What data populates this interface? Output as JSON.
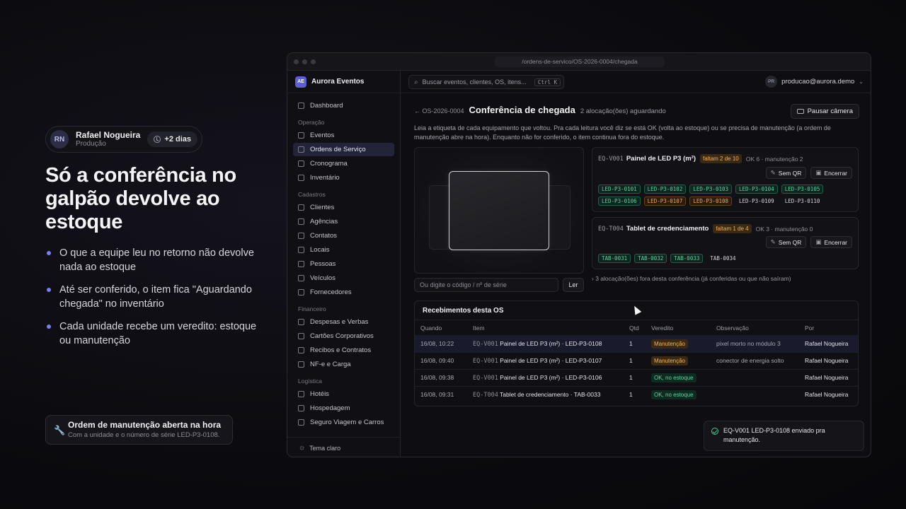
{
  "narrative": {
    "user": {
      "initials": "RN",
      "name": "Rafael Nogueira",
      "role": "Produção",
      "badge": "+2 dias"
    },
    "headline": "Só a conferência no galpão devolve ao estoque",
    "bullets": [
      "O que a equipe leu no retorno não devolve nada ao estoque",
      "Até ser conferido, o item fica \"Aguardando chegada\" no inventário",
      "Cada unidade recebe um veredito: estoque ou manutenção"
    ],
    "callout": {
      "title": "Ordem de manutenção aberta na hora",
      "subtitle": "Com a unidade e o número de série LED-P3-0108."
    }
  },
  "window": {
    "url": "/ordens-de-servico/OS-2026-0004/chegada"
  },
  "sidebar": {
    "brand_logo": "AE",
    "brand_name": "Aurora Eventos",
    "dashboard": "Dashboard",
    "sections": [
      {
        "title": "Operação",
        "items": [
          "Eventos",
          "Ordens de Serviço",
          "Cronograma",
          "Inventário"
        ]
      },
      {
        "title": "Cadastros",
        "items": [
          "Clientes",
          "Agências",
          "Contatos",
          "Locais",
          "Pessoas",
          "Veículos",
          "Fornecedores"
        ]
      },
      {
        "title": "Financeiro",
        "items": [
          "Despesas e Verbas",
          "Cartões Corporativos",
          "Recibos e Contratos",
          "NF-e e Carga"
        ]
      },
      {
        "title": "Logística",
        "items": [
          "Hotéis",
          "Hospedagem",
          "Seguro Viagem e Carros"
        ]
      }
    ],
    "theme_toggle": "Tema claro"
  },
  "topbar": {
    "search_placeholder": "Buscar eventos, clientes, OS, itens...",
    "shortcut": "Ctrl K",
    "account_initials": "PR",
    "account_email": "producao@aurora.demo"
  },
  "page": {
    "back": "← OS-2026-0004",
    "title": "Conferência de chegada",
    "subtitle": "2 alocação(ões) aguardando",
    "pause_button": "Pausar câmera",
    "description": "Leia a etiqueta de cada equipamento que voltou. Pra cada leitura você diz se está OK (volta ao estoque) ou se precisa de manutenção (a ordem de manutenção abre na hora). Enquanto não for conferido, o item continua fora do estoque.",
    "code_placeholder": "Ou digite o código / nº de série",
    "read_button": "Ler",
    "outside_note": "› 3 alocação(ões) fora desta conferência (já conferidas ou que não saíram)"
  },
  "equipment": [
    {
      "code": "EQ-V001",
      "name": "Painel de LED P3 (m²)",
      "missing": "faltam 2 de 10",
      "stats": "OK 6 · manutenção 2",
      "actions": [
        "Sem QR",
        "Encerrar"
      ],
      "serials": [
        {
          "id": "LED-P3-0101",
          "status": "ok"
        },
        {
          "id": "LED-P3-0102",
          "status": "ok"
        },
        {
          "id": "LED-P3-0103",
          "status": "ok"
        },
        {
          "id": "LED-P3-0104",
          "status": "ok"
        },
        {
          "id": "LED-P3-0105",
          "status": "ok"
        },
        {
          "id": "LED-P3-0106",
          "status": "ok"
        },
        {
          "id": "LED-P3-0107",
          "status": "maint"
        },
        {
          "id": "LED-P3-0108",
          "status": "maint"
        },
        {
          "id": "LED-P3-0109",
          "status": "pending"
        },
        {
          "id": "LED-P3-0110",
          "status": "pending"
        }
      ]
    },
    {
      "code": "EQ-T004",
      "name": "Tablet de credenciamento",
      "missing": "faltam 1 de 4",
      "stats": "OK 3 · manutenção 0",
      "actions": [
        "Sem QR",
        "Encerrar"
      ],
      "serials": [
        {
          "id": "TAB-0031",
          "status": "ok"
        },
        {
          "id": "TAB-0032",
          "status": "ok"
        },
        {
          "id": "TAB-0033",
          "status": "ok"
        },
        {
          "id": "TAB-0034",
          "status": "pending"
        }
      ]
    }
  ],
  "receipts": {
    "title": "Recebimentos desta OS",
    "columns": [
      "Quando",
      "Item",
      "Qtd",
      "Veredito",
      "Observação",
      "Por"
    ],
    "rows": [
      {
        "when": "16/08, 10:22",
        "code": "EQ-V001",
        "item": "Painel de LED P3 (m²) · LED-P3-0108",
        "qty": "1",
        "verdict": "Manutenção",
        "verdict_type": "maint",
        "note": "pixel morto no módulo 3",
        "by": "Rafael Nogueira"
      },
      {
        "when": "16/08, 09:40",
        "code": "EQ-V001",
        "item": "Painel de LED P3 (m²) · LED-P3-0107",
        "qty": "1",
        "verdict": "Manutenção",
        "verdict_type": "maint",
        "note": "conector de energia solto",
        "by": "Rafael Nogueira"
      },
      {
        "when": "16/08, 09:38",
        "code": "EQ-V001",
        "item": "Painel de LED P3 (m²) · LED-P3-0106",
        "qty": "1",
        "verdict": "OK, no estoque",
        "verdict_type": "ok",
        "note": "",
        "by": "Rafael Nogueira"
      },
      {
        "when": "16/08, 09:31",
        "code": "EQ-T004",
        "item": "Tablet de credenciamento · TAB-0033",
        "qty": "1",
        "verdict": "OK, no estoque",
        "verdict_type": "ok",
        "note": "",
        "by": "Rafael Nogueira"
      }
    ]
  },
  "toast": {
    "message": "EQ-V001 LED-P3-0108 enviado pra manutenção."
  }
}
